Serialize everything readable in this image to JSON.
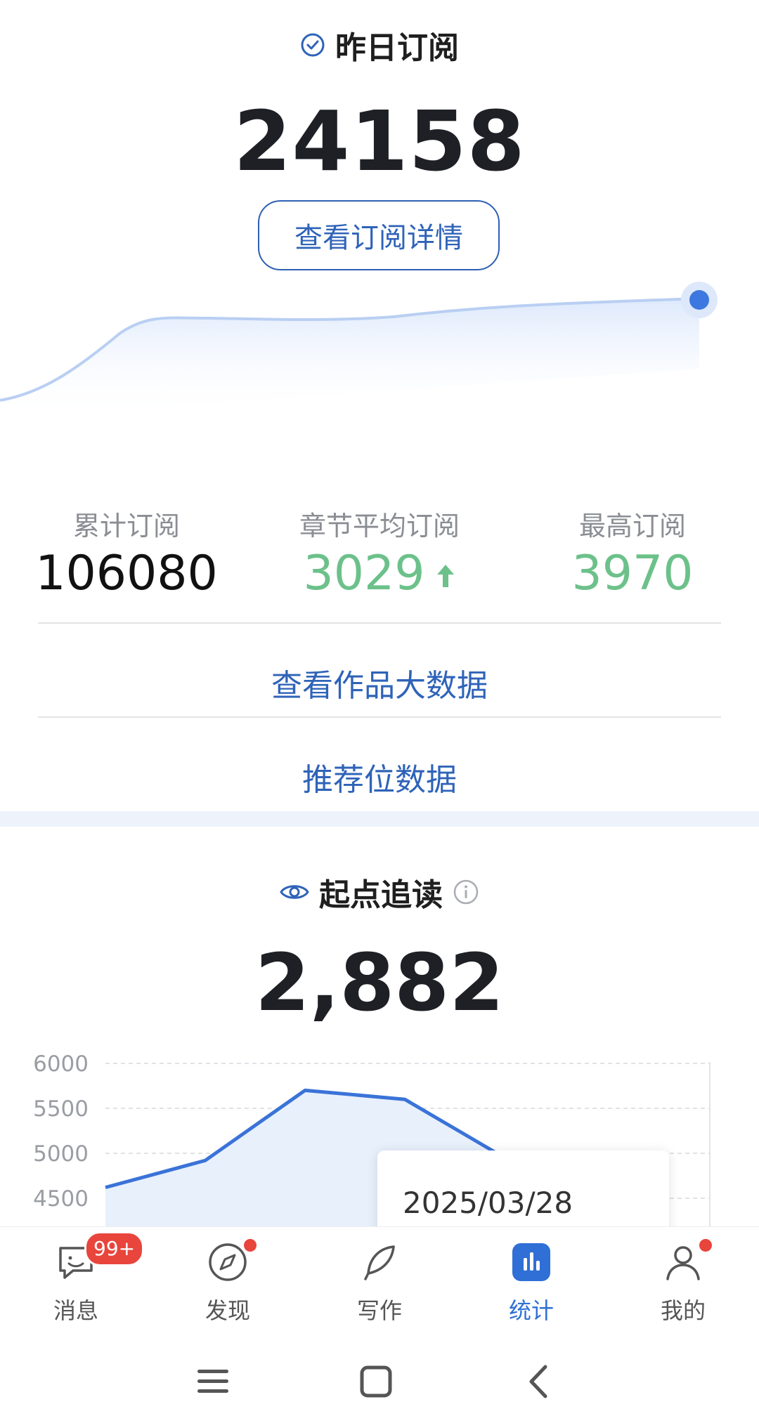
{
  "subscription": {
    "title": "昨日订阅",
    "value": "24158",
    "detail_button": "查看订阅详情"
  },
  "stats": {
    "total_label": "累计订阅",
    "total_value": "106080",
    "avg_label": "章节平均订阅",
    "avg_value": "3029",
    "max_label": "最高订阅",
    "max_value": "3970"
  },
  "links": {
    "work_data": "查看作品大数据",
    "recommend_data": "推荐位数据"
  },
  "follow_read": {
    "title": "起点追读",
    "value": "2,882"
  },
  "chart_data": {
    "type": "area",
    "y_ticks": [
      "6000",
      "5500",
      "5000",
      "4500"
    ],
    "ylim": [
      4500,
      6000
    ],
    "series": [
      {
        "values": [
          4620,
          4920,
          5700,
          5600,
          4950
        ]
      }
    ],
    "tooltip_date": "2025/03/28"
  },
  "colors": {
    "accent": "#2f63b8",
    "green": "#6cc18a",
    "badge_red": "#e8453c",
    "active_tab": "#2f6fd6"
  },
  "bottom_nav": {
    "items": [
      {
        "label": "消息",
        "icon": "message-icon",
        "badge": "99+"
      },
      {
        "label": "发现",
        "icon": "compass-icon"
      },
      {
        "label": "写作",
        "icon": "feather-icon"
      },
      {
        "label": "统计",
        "icon": "stats-icon"
      },
      {
        "label": "我的",
        "icon": "user-icon"
      }
    ],
    "active_index": 3
  }
}
